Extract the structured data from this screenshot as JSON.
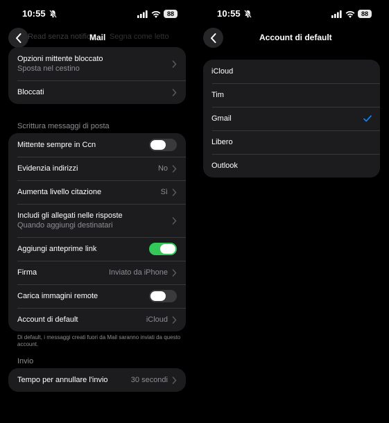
{
  "status": {
    "time": "10:55",
    "battery": "88"
  },
  "left": {
    "nav_title": "Mail",
    "ghost_left": "Read senza notifica",
    "ghost_right": "Segna come letto",
    "group1": [
      {
        "label": "Opzioni mittente bloccato",
        "sub": "Sposta nel cestino"
      },
      {
        "label": "Bloccati"
      }
    ],
    "section_compose": "Scrittura messaggi di posta",
    "group2": [
      {
        "label": "Mittente sempre in Ccn",
        "toggle": false
      },
      {
        "label": "Evidenzia indirizzi",
        "value": "No"
      },
      {
        "label": "Aumenta livello citazione",
        "value": "Sì"
      },
      {
        "label": "Includi gli allegati nelle risposte",
        "sub": "Quando aggiungi destinatari"
      },
      {
        "label": "Aggiungi anteprime link",
        "toggle": true
      },
      {
        "label": "Firma",
        "value": "Inviato da iPhone"
      },
      {
        "label": "Carica immagini remote",
        "toggle": false
      },
      {
        "label": "Account di default",
        "value": "iCloud"
      }
    ],
    "footer_note": "Di default, i messaggi creati fuori da Mail saranno inviati da questo account.",
    "section_send": "Invio",
    "group3": [
      {
        "label": "Tempo per annullare l'invio",
        "value": "30 secondi"
      }
    ]
  },
  "right": {
    "nav_title": "Account di default",
    "accounts": [
      "iCloud",
      "Tim",
      "Gmail",
      "Libero",
      "Outlook"
    ],
    "selected": "Gmail"
  },
  "colors": {
    "accent": "#0a84ff",
    "toggle_on": "#34c759",
    "cell": "#1c1c1e"
  },
  "icons": [
    "bell-slash-icon",
    "cellular-signal-icon",
    "wifi-icon",
    "battery-icon",
    "back-chevron-icon",
    "disclosure-chevron-icon",
    "checkmark-icon"
  ]
}
